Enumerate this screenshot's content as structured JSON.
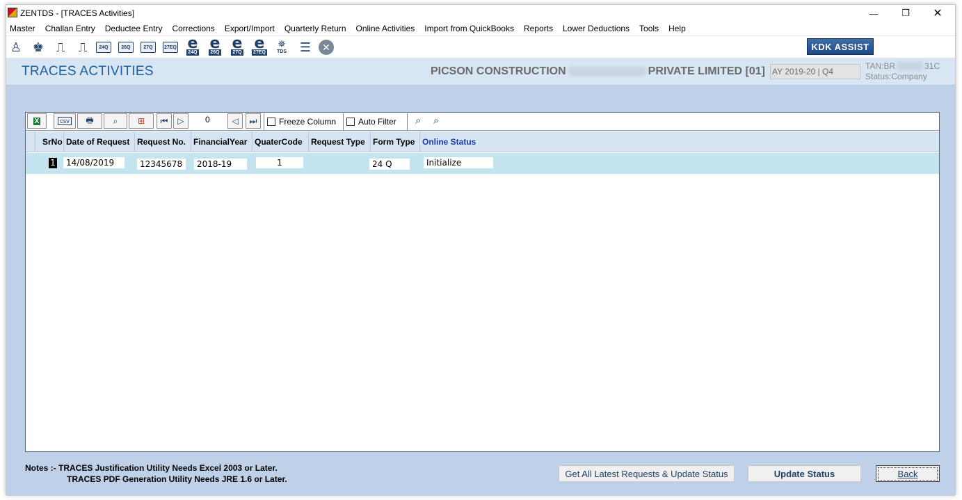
{
  "window": {
    "title": "ZENTDS - [TRACES Activities]",
    "controls": {
      "minimize": "—",
      "restore": "❐",
      "close": "✕"
    }
  },
  "menu": [
    "Master",
    "Challan Entry",
    "Deductee Entry",
    "Corrections",
    "Export/Import",
    "Quarterly Return",
    "Online Activities",
    "Import from QuickBooks",
    "Reports",
    "Lower Deductions",
    "Tools",
    "Help"
  ],
  "toolbar": {
    "form_icons": [
      "24Q",
      "26Q",
      "27Q",
      "27EQ"
    ],
    "e_icons": [
      "24Q",
      "26Q",
      "27Q",
      "27EQ"
    ],
    "tds_label": "TDS",
    "assist_label": "KDK ASSIST"
  },
  "header": {
    "title": "TRACES ACTIVITIES",
    "company_part1": "PICSON CONSTRUCTION",
    "company_part2": "PRIVATE LIMITED [01]",
    "ay": "AY 2019-20 | Q4",
    "tan_prefix": "TAN:BR",
    "tan_suffix": "31C",
    "status": "Status:Company"
  },
  "grid_toolbar": {
    "counter": "0",
    "freeze_label": "Freeze Column",
    "autofilter_label": "Auto Filter"
  },
  "grid": {
    "columns": [
      "SrNo",
      "Date of Request",
      "Request No.",
      "FinancialYear",
      "QuaterCode",
      "Request Type",
      "Form Type",
      "Online Status"
    ],
    "rows": [
      {
        "srno": "1",
        "date": "14/08/2019",
        "request_no": "12345678",
        "fy": "2018-19",
        "quarter": "1",
        "request_type": "",
        "form_type": "24 Q",
        "status": "Initialize"
      }
    ]
  },
  "notes": {
    "line1": "Notes :- TRACES Justification Utility Needs Excel 2003 or Later.",
    "line2": "TRACES PDF Generation Utility Needs JRE 1.6 or Later."
  },
  "buttons": {
    "latest": "Get All Latest Requests & Update Status",
    "update": "Update Status",
    "back": "Back"
  },
  "colors": {
    "accent": "#1b5f9f",
    "background": "#bed1e8",
    "row_highlight": "#c4e4ef"
  }
}
